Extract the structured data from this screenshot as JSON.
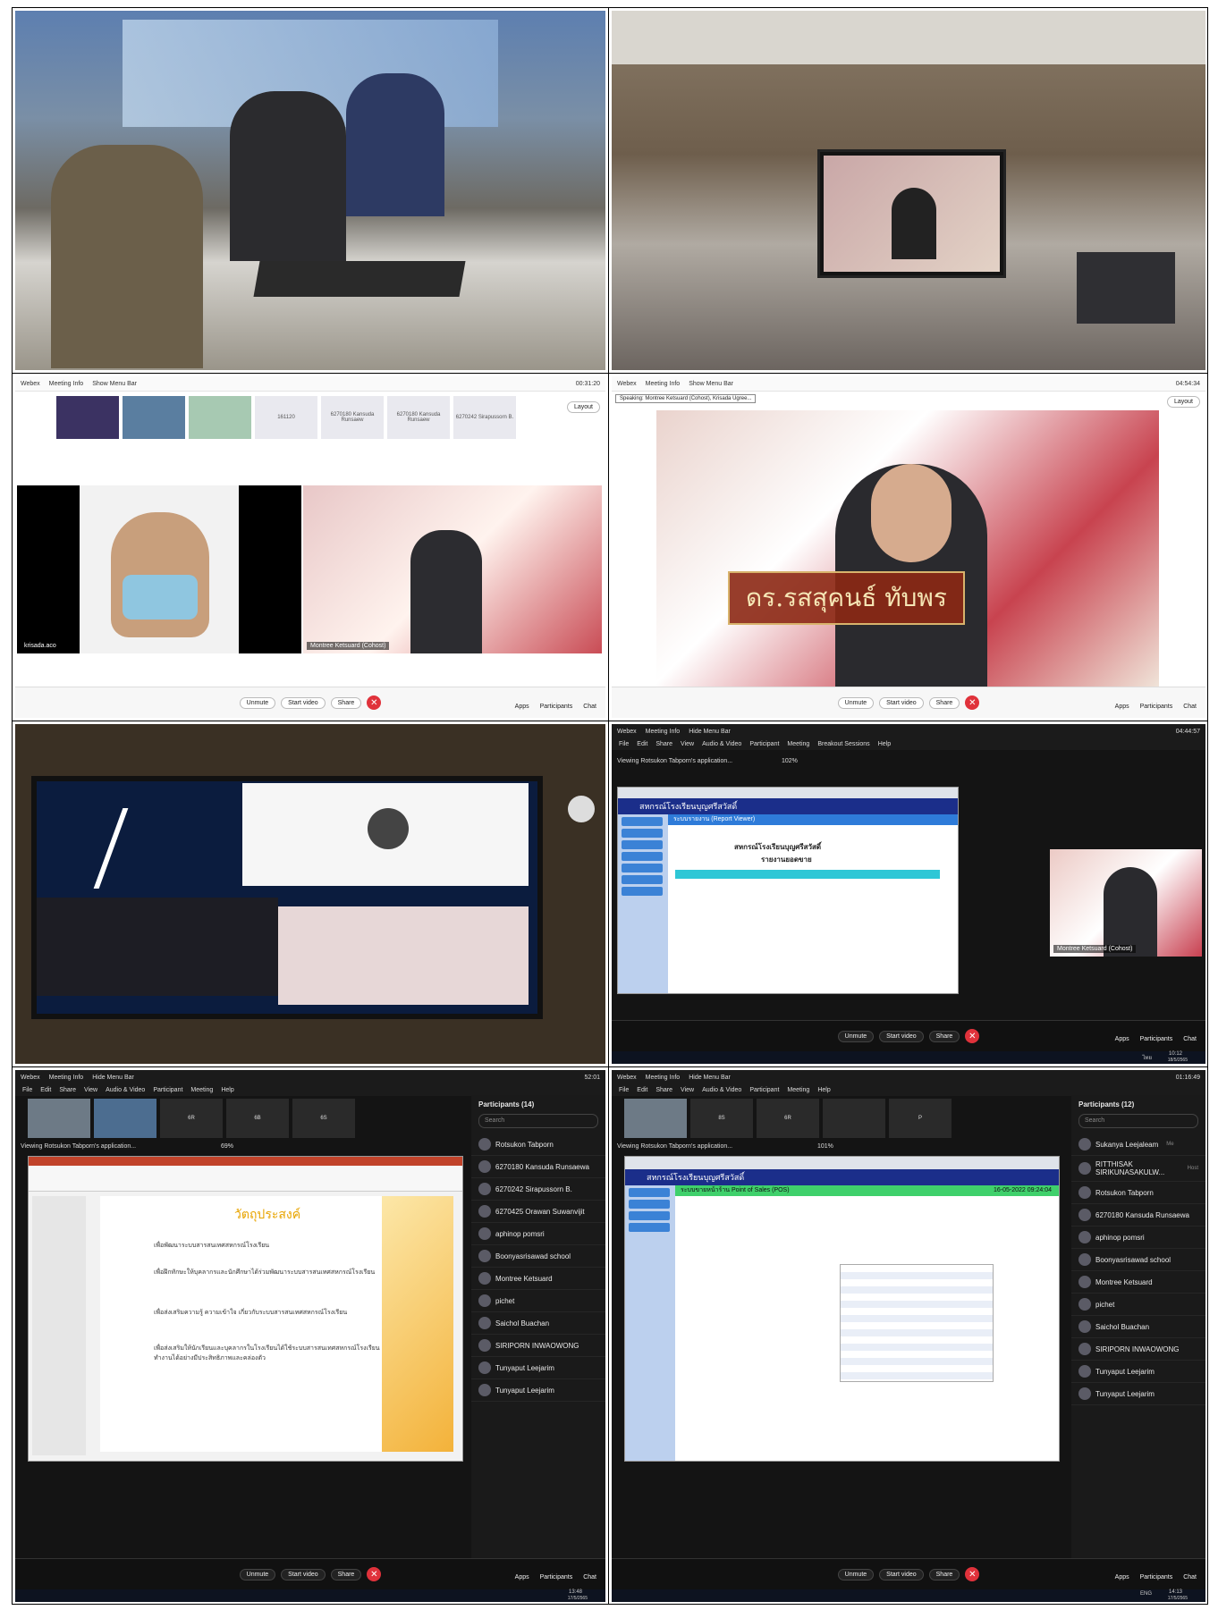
{
  "colors": {
    "leave": "#e0323b",
    "webex_blue": "#1b2e8a",
    "pos_green": "#3fd06b",
    "slide_gold": "#e8a400"
  },
  "toolbar": {
    "unmute": "Unmute",
    "start_video": "Start video",
    "share": "Share",
    "apps": "Apps",
    "participants": "Participants",
    "chat": "Chat",
    "layout": "Layout"
  },
  "webex_bar": {
    "app": "Webex",
    "meeting_info": "Meeting Info",
    "show_menu_bar": "Show Menu Bar",
    "hide_menu_bar": "Hide Menu Bar"
  },
  "menu": [
    "File",
    "Edit",
    "Share",
    "View",
    "Audio & Video",
    "Participant",
    "Meeting",
    "Breakout Sessions",
    "Help"
  ],
  "panel3": {
    "time": "00:31:20",
    "thumbs": [
      "161120",
      "6270180 Kansuda Runsaew",
      "6270180 Kansuda Runsaew",
      "6270242 Sirapussorn B."
    ],
    "left_name": "krisada.aco",
    "right_name": "Montree Ketsuard (Cohost)"
  },
  "panel4": {
    "time": "04:54:34",
    "speaking": "Speaking: Montree Ketsuard (Cohost), Krisada Ugree...",
    "caption": "ดร.รสสุคนธ์ ทับพร"
  },
  "panel6": {
    "time": "04:44:57",
    "viewing": "Viewing Rotsukon Tabporn's application...",
    "zoom": "102%",
    "site_title": "สหกรณ์โรงเรียนบุญศรีสวัสดิ์",
    "report_bar": "ระบบรายงาน (Report Viewer)",
    "report_title": "สหกรณ์โรงเรียนบุญศรีสวัสดิ์",
    "report_sub": "รายงานยอดขาย",
    "self_name": "Montree Ketsuard (Cohost)",
    "clock": "10:12",
    "date": "18/5/2565",
    "lang": "ไทย"
  },
  "panel7": {
    "time": "52:01",
    "viewing": "Viewing Rotsukon Tabporn's application...",
    "zoom": "69%",
    "tiles": [
      "6R",
      "6B",
      "6S"
    ],
    "slide_title": "วัตถุประสงค์",
    "bullets": [
      "เพื่อพัฒนาระบบสารสนเทศสหกรณ์โรงเรียน",
      "เพื่อฝึกทักษะให้บุคลากรและนักศึกษาได้ร่วมพัฒนาระบบสารสนเทศสหกรณ์โรงเรียน",
      "เพื่อส่งเสริมความรู้ ความเข้าใจ เกี่ยวกับระบบสารสนเทศสหกรณ์โรงเรียน",
      "เพื่อส่งเสริมให้นักเรียนและบุคลากรในโรงเรียนได้ใช้ระบบสารสนเทศสหกรณ์โรงเรียนทำงานได้อย่างมีประสิทธิภาพและคล่องตัว"
    ],
    "participants_title": "Participants (14)",
    "search": "Search",
    "participants": [
      "Rotsukon Tabporn",
      "6270180 Kansuda Runsaewa",
      "6270242 Sirapussorn B.",
      "6270425 Orawan Suwanvijit",
      "aphinop pomsri",
      "Boonyasrisawad school",
      "Montree Ketsuard",
      "pichet",
      "Saichol Buachan",
      "SIRIPORN INWAOWONG",
      "Tunyaput Leejarim",
      "Tunyaput Leejarim"
    ],
    "clock": "13:48",
    "date": "17/5/2565"
  },
  "panel8": {
    "time": "01:16:49",
    "viewing": "Viewing Rotsukon Tabporn's application...",
    "zoom": "101%",
    "tiles": [
      "8S",
      "6R",
      "P"
    ],
    "site_title": "สหกรณ์โรงเรียนบุญศรีสวัสดิ์",
    "pos_bar": "ระบบขายหน้าร้าน Point of Sales (POS)",
    "pos_date": "16-05-2022 09:24:04",
    "participants_title": "Participants (12)",
    "search": "Search",
    "participants": [
      "Sukanya Leejaleam",
      "RITTHISAK SIRIKUNASAKULW...",
      "Rotsukon Tabporn",
      "6270180 Kansuda Runsaewa",
      "aphinop pomsri",
      "Boonyasrisawad school",
      "Montree Ketsuard",
      "pichet",
      "Saichol Buachan",
      "SIRIPORN INWAOWONG",
      "Tunyaput Leejarim",
      "Tunyaput Leejarim"
    ],
    "first_role": "Me",
    "second_role": "Host",
    "clock": "14:13",
    "date": "17/5/2565",
    "lang": "ENG"
  }
}
